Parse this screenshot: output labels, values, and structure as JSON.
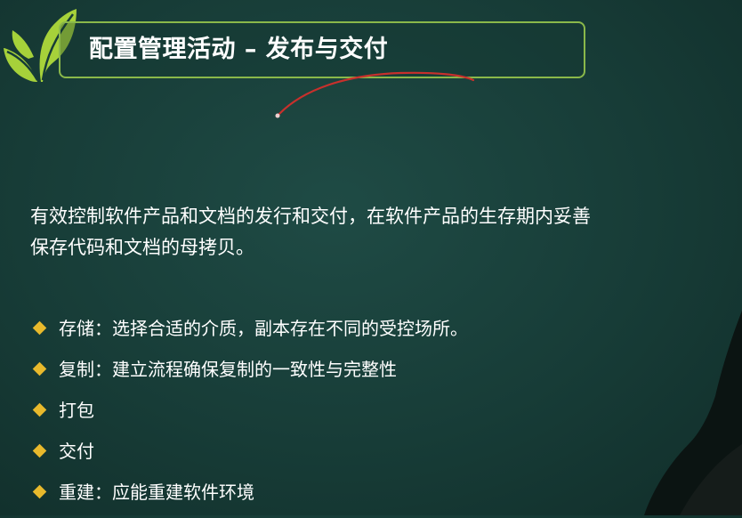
{
  "slide": {
    "title": "配置管理活动 – 发布与交付",
    "intro_lines": [
      "有效控制软件产品和文档的发行和交付，在软件产品的生存期内妥善",
      "保存代码和文档的母拷贝。"
    ],
    "bullets": [
      "存储：选择合适的介质，副本存在不同的受控场所。",
      "复制：建立流程确保复制的一致性与完整性",
      "打包",
      "交付",
      "重建：应能重建软件环境"
    ]
  },
  "colors": {
    "background": "#173c37",
    "title_border": "#8ab84a",
    "leaf": "#a6d13a",
    "bullet_diamond": "#e8b92c",
    "pen_stroke": "#c8302c",
    "text": "#ffffff"
  },
  "icons": {
    "logo": "leaf-logo-icon",
    "bullet": "diamond-bullet-icon"
  }
}
